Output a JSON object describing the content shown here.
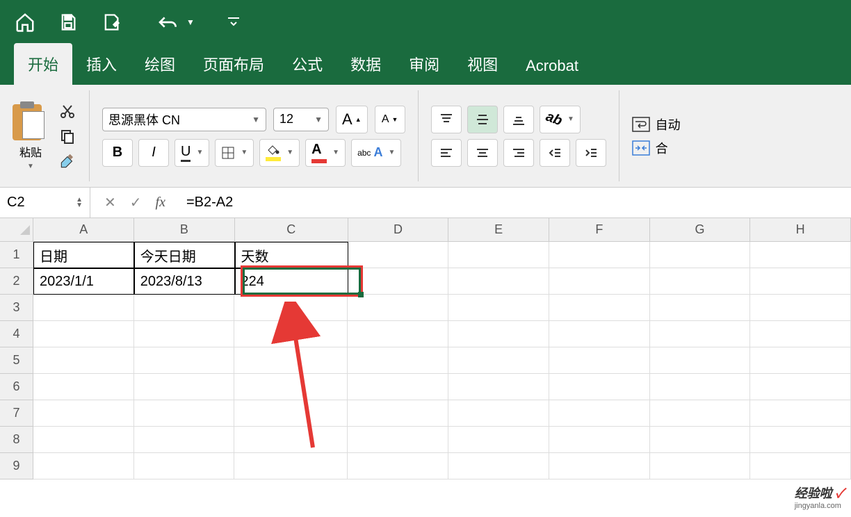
{
  "tabs": {
    "home": "开始",
    "insert": "插入",
    "draw": "绘图",
    "layout": "页面布局",
    "formula": "公式",
    "data": "数据",
    "review": "审阅",
    "view": "视图",
    "acrobat": "Acrobat"
  },
  "ribbon": {
    "paste": "粘贴",
    "font_name": "思源黑体 CN",
    "font_size": "12",
    "bold": "B",
    "italic": "I",
    "underline": "U",
    "abc": "abc",
    "big_a": "A",
    "small_a": "A",
    "color_a": "A",
    "auto": "自动",
    "merge": "合"
  },
  "formula_bar": {
    "name_box": "C2",
    "fx": "fx",
    "formula": "=B2-A2"
  },
  "columns": [
    "A",
    "B",
    "C",
    "D",
    "E",
    "F",
    "G",
    "H"
  ],
  "rows": [
    "1",
    "2",
    "3",
    "4",
    "5",
    "6",
    "7",
    "8",
    "9"
  ],
  "cells": {
    "A1": "日期",
    "B1": "今天日期",
    "C1": "天数",
    "A2": "2023/1/1",
    "B2": "2023/8/13",
    "C2": "224"
  },
  "watermark": {
    "text": "经验啦",
    "sub": "jingyanla.com",
    "check": "✓"
  }
}
